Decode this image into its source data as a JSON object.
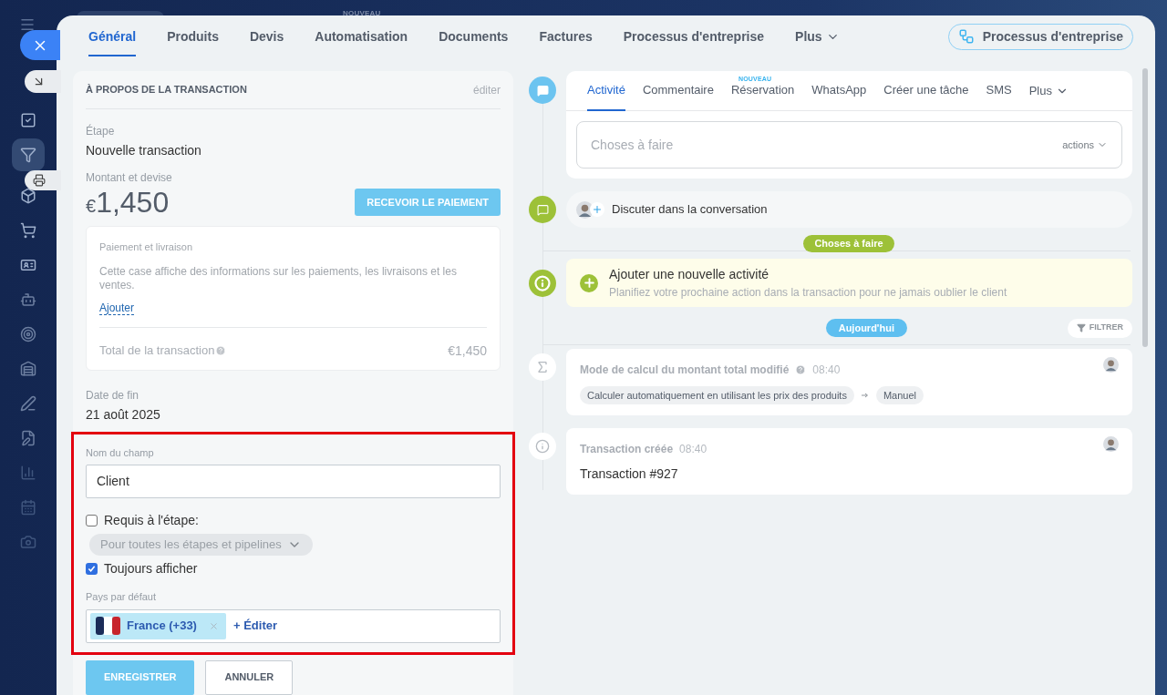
{
  "background": {
    "badge": "NOUVEAU"
  },
  "tabs": [
    {
      "label": "Général",
      "selected": true
    },
    {
      "label": "Produits",
      "selected": false
    },
    {
      "label": "Devis",
      "selected": false
    },
    {
      "label": "Automatisation",
      "selected": false
    },
    {
      "label": "Documents",
      "selected": false
    },
    {
      "label": "Factures",
      "selected": false
    },
    {
      "label": "Processus d'entreprise",
      "selected": false
    }
  ],
  "tabs_more": "Plus",
  "process_button": "Processus d'entreprise",
  "about": {
    "title": "À PROPOS DE LA TRANSACTION",
    "edit": "éditer",
    "stage_label": "Étape",
    "stage": "Nouvelle transaction",
    "amount_label": "Montant et devise",
    "currency": "€",
    "amount": "1,450",
    "pay_button": "RECEVOIR LE PAIEMENT",
    "payment": {
      "title": "Paiement et livraison",
      "description": "Cette case affiche des informations sur les paiements, les livraisons et les ventes.",
      "add": "Ajouter",
      "total_label": "Total de la transaction",
      "total": "€1,450"
    },
    "end_date_label": "Date de fin",
    "end_date": "21 août 2025"
  },
  "field_editor": {
    "name_label": "Nom du champ",
    "name_value": "Client",
    "options": [
      {
        "label": "Requis à l'étape:",
        "checked": false,
        "dropdown": "Pour toutes les étapes et pipelines"
      },
      {
        "label": "Toujours afficher",
        "checked": true
      }
    ],
    "country_label": "Pays par défaut",
    "country_tag": "France (+33)",
    "edit_link": "+ Éditer"
  },
  "buttons": {
    "save": "ENREGISTRER",
    "cancel": "ANNULER"
  },
  "activity": {
    "new_badge": "NOUVEAU",
    "tabs": [
      {
        "label": "Activité",
        "selected": true
      },
      {
        "label": "Commentaire",
        "selected": false
      },
      {
        "label": "Réservation",
        "selected": false
      },
      {
        "label": "WhatsApp",
        "selected": false
      },
      {
        "label": "Créer une tâche",
        "selected": false
      },
      {
        "label": "SMS",
        "selected": false
      }
    ],
    "more": "Plus",
    "placeholder": "Choses à faire",
    "actions": "actions"
  },
  "chat": "Discuter dans la conversation",
  "todo_divider": "Choses à faire",
  "new_activity": {
    "title": "Ajouter une nouvelle activité",
    "subtitle": "Planifiez votre prochaine action dans la transaction pour ne jamais oublier le client"
  },
  "today_divider": "Aujourd'hui",
  "filter": "FILTRER",
  "events": [
    {
      "kind": "change",
      "title": "Mode de calcul du montant total modifié",
      "time": "08:40",
      "from": "Calculer automatiquement en utilisant les prix des produits",
      "to": "Manuel"
    },
    {
      "kind": "info",
      "title": "Transaction créée",
      "time": "08:40",
      "text": "Transaction #927"
    }
  ]
}
